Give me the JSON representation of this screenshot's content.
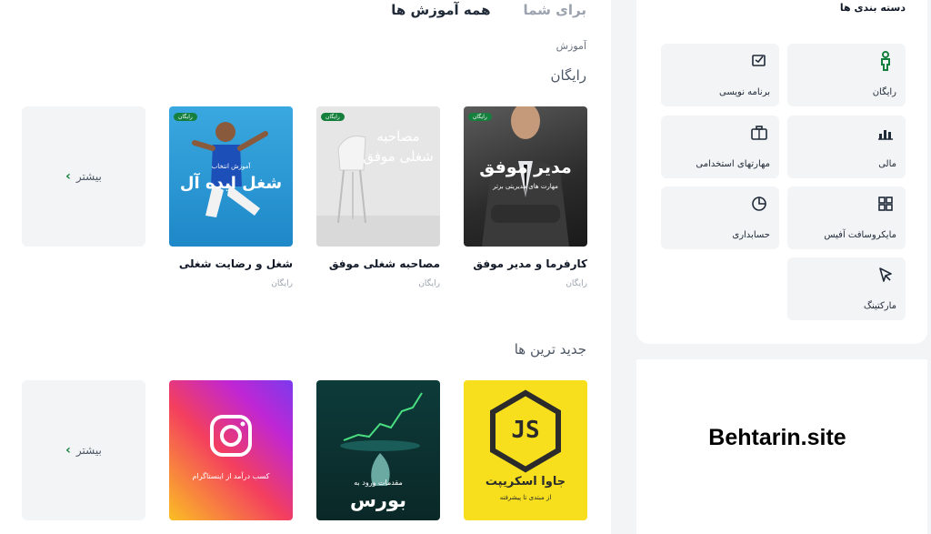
{
  "tabs": {
    "all": "همه آموزش ها",
    "for_you": "برای شما"
  },
  "breadcrumb": "آموزش",
  "sections": {
    "free": "رایگان",
    "newest": "جدید ترین ها"
  },
  "more_label": "بیشتر",
  "free_courses": [
    {
      "title": "کارفرما و مدیر موفق",
      "price": "رایگان",
      "badge": "رایگان",
      "thumb_title": "مدیر موفق",
      "thumb_sub": "مهارت های مدیریتی برتر"
    },
    {
      "title": "مصاحبه شغلی موفق",
      "price": "رایگان",
      "badge": "رایگان",
      "thumb_title": "مصاحبه شغلی موفق",
      "thumb_sub": ""
    },
    {
      "title": "شغل و رضایت شغلی",
      "price": "رایگان",
      "badge": "رایگان",
      "thumb_title": "شغل ایده آل",
      "thumb_sub": "آموزش انتخاب"
    }
  ],
  "new_courses": [
    {
      "thumb_title": "جاوا اسکریپت",
      "thumb_sub": "از مبتدی تا پیشرفته",
      "logo": "JS"
    },
    {
      "thumb_title": "بورس",
      "thumb_sub": "مقدمات ورود به"
    },
    {
      "thumb_title": "کسب درآمد از اینستاگرام",
      "thumb_sub": ""
    }
  ],
  "categories": {
    "title": "دسته بندی ها",
    "items": [
      {
        "label": "رایگان",
        "icon": "person-icon"
      },
      {
        "label": "برنامه نویسی",
        "icon": "code-icon"
      },
      {
        "label": "مالی",
        "icon": "finance-icon"
      },
      {
        "label": "مهارتهای استخدامی",
        "icon": "briefcase-icon"
      },
      {
        "label": "مایکروسافت آفیس",
        "icon": "grid-icon"
      },
      {
        "label": "حسابداری",
        "icon": "pie-chart-icon"
      },
      {
        "label": "مارکتینگ",
        "icon": "cursor-icon"
      }
    ]
  },
  "ad_text": "Behtarin.site",
  "colors": {
    "accent": "#15803d",
    "js_yellow": "#f7df1e",
    "card_bg": "#f3f4f6"
  }
}
